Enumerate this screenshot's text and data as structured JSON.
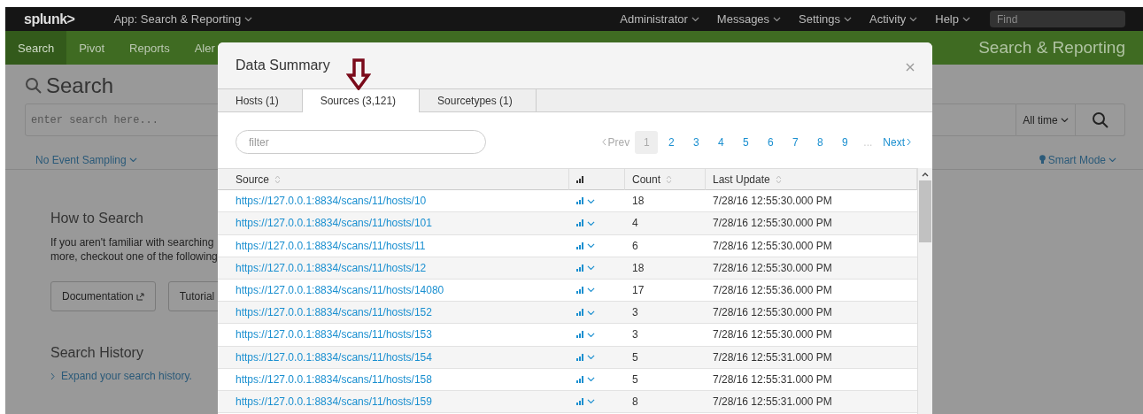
{
  "top_bar": {
    "logo": "splunk>",
    "app": "App: Search & Reporting",
    "menus": [
      "Administrator",
      "Messages",
      "Settings",
      "Activity",
      "Help"
    ],
    "find_placeholder": "Find"
  },
  "nav": {
    "items": [
      {
        "label": "Search",
        "selected": true
      },
      {
        "label": "Pivot",
        "selected": false
      },
      {
        "label": "Reports",
        "selected": false
      },
      {
        "label": "Aler",
        "selected": false
      }
    ],
    "app_title": "Search & Reporting"
  },
  "search_page": {
    "title": "Search",
    "search_placeholder": "enter search here...",
    "time_range": "All time",
    "sampling": "No Event Sampling",
    "mode": "Smart Mode",
    "how_to_heading": "How to Search",
    "how_to_lines": [
      "If you aren't familiar with searching",
      "more, checkout one of the following"
    ],
    "buttons": [
      "Documentation",
      "Tutorial"
    ],
    "history_heading": "Search History",
    "history_link": "Expand your search history."
  },
  "dialog": {
    "title": "Data Summary",
    "tabs": [
      {
        "label": "Hosts (1)",
        "selected": false
      },
      {
        "label": "Sources (3,121)",
        "selected": true
      },
      {
        "label": "Sourcetypes (1)",
        "selected": false
      }
    ],
    "filter_placeholder": "filter",
    "pagination": {
      "prev": {
        "label": "Prev",
        "disabled": true
      },
      "pages": [
        {
          "label": "1",
          "selected": true
        },
        {
          "label": "2",
          "selected": false
        },
        {
          "label": "3",
          "selected": false
        },
        {
          "label": "4",
          "selected": false
        },
        {
          "label": "5",
          "selected": false
        },
        {
          "label": "6",
          "selected": false
        },
        {
          "label": "7",
          "selected": false
        },
        {
          "label": "8",
          "selected": false
        },
        {
          "label": "9",
          "selected": false
        }
      ],
      "ellipsis": "...",
      "next": {
        "label": "Next",
        "disabled": false
      }
    },
    "table": {
      "columns": [
        "Source",
        "Count",
        "Last Update"
      ],
      "rows": [
        {
          "source": "https://127.0.0.1:8834/scans/11/hosts/10",
          "count": "18",
          "last_update": "7/28/16 12:55:30.000 PM"
        },
        {
          "source": "https://127.0.0.1:8834/scans/11/hosts/101",
          "count": "4",
          "last_update": "7/28/16 12:55:30.000 PM"
        },
        {
          "source": "https://127.0.0.1:8834/scans/11/hosts/11",
          "count": "6",
          "last_update": "7/28/16 12:55:30.000 PM"
        },
        {
          "source": "https://127.0.0.1:8834/scans/11/hosts/12",
          "count": "18",
          "last_update": "7/28/16 12:55:30.000 PM"
        },
        {
          "source": "https://127.0.0.1:8834/scans/11/hosts/14080",
          "count": "17",
          "last_update": "7/28/16 12:55:36.000 PM"
        },
        {
          "source": "https://127.0.0.1:8834/scans/11/hosts/152",
          "count": "3",
          "last_update": "7/28/16 12:55:30.000 PM"
        },
        {
          "source": "https://127.0.0.1:8834/scans/11/hosts/153",
          "count": "3",
          "last_update": "7/28/16 12:55:30.000 PM"
        },
        {
          "source": "https://127.0.0.1:8834/scans/11/hosts/154",
          "count": "5",
          "last_update": "7/28/16 12:55:31.000 PM"
        },
        {
          "source": "https://127.0.0.1:8834/scans/11/hosts/158",
          "count": "5",
          "last_update": "7/28/16 12:55:31.000 PM"
        },
        {
          "source": "https://127.0.0.1:8834/scans/11/hosts/159",
          "count": "8",
          "last_update": "7/28/16 12:55:31.000 PM"
        }
      ]
    }
  }
}
